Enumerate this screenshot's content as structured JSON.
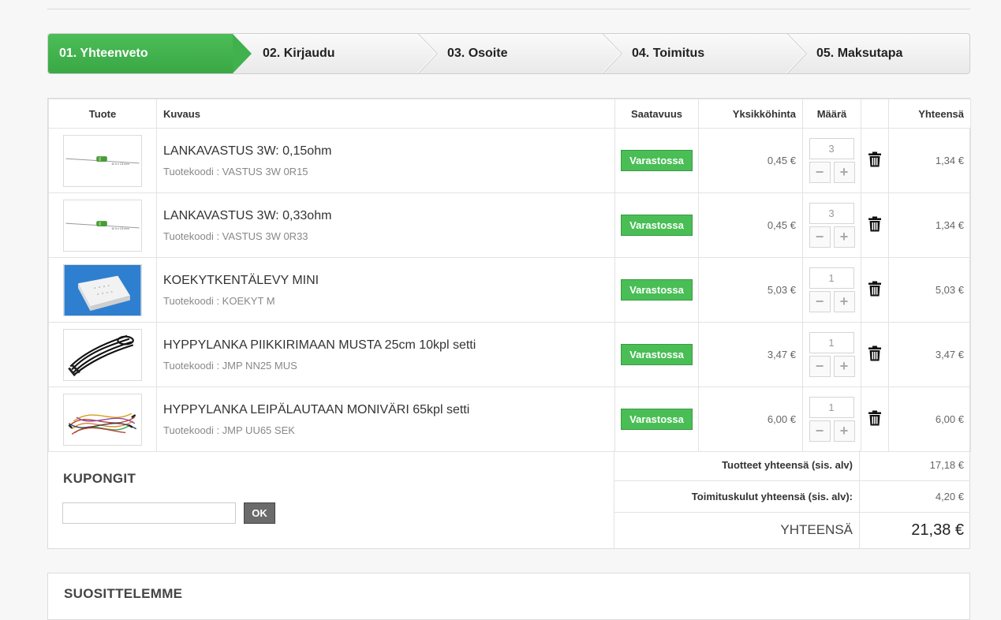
{
  "steps": [
    {
      "label": "01. Yhteenveto",
      "active": true
    },
    {
      "label": "02. Kirjaudu",
      "active": false
    },
    {
      "label": "03. Osoite",
      "active": false
    },
    {
      "label": "04. Toimitus",
      "active": false
    },
    {
      "label": "05. Maksutapa",
      "active": false
    }
  ],
  "table": {
    "headers": {
      "product": "Tuote",
      "description": "Kuvaus",
      "availability": "Saatavuus",
      "unit_price": "Yksikköhinta",
      "quantity": "Määrä",
      "total": "Yhteensä"
    },
    "rows": [
      {
        "name": "LANKAVASTUS 3W: 0,15ohm",
        "code": "Tuotekoodi : VASTUS 3W 0R15",
        "availability": "Varastossa",
        "unit_price": "0,45 €",
        "qty": "3",
        "total": "1,34 €",
        "image": "resistor"
      },
      {
        "name": "LANKAVASTUS 3W: 0,33ohm",
        "code": "Tuotekoodi : VASTUS 3W 0R33",
        "availability": "Varastossa",
        "unit_price": "0,45 €",
        "qty": "3",
        "total": "1,34 €",
        "image": "resistor"
      },
      {
        "name": "KOEKYTKENTÄLEVY MINI",
        "code": "Tuotekoodi : KOEKYT M",
        "availability": "Varastossa",
        "unit_price": "5,03 €",
        "qty": "1",
        "total": "5,03 €",
        "image": "breadboard"
      },
      {
        "name": "HYPPYLANKA PIIKKIRIMAAN MUSTA 25cm 10kpl setti",
        "code": "Tuotekoodi : JMP NN25 MUS",
        "availability": "Varastossa",
        "unit_price": "3,47 €",
        "qty": "1",
        "total": "3,47 €",
        "image": "black-wires"
      },
      {
        "name": "HYPPYLANKA LEIPÄLAUTAAN MONIVÄRI 65kpl setti",
        "code": "Tuotekoodi : JMP UU65 SEK",
        "availability": "Varastossa",
        "unit_price": "6,00 €",
        "qty": "1",
        "total": "6,00 €",
        "image": "color-wires"
      }
    ]
  },
  "coupon": {
    "title": "KUPONGIT",
    "input_value": "",
    "button": "OK"
  },
  "totals": {
    "products_label": "Tuotteet yhteensä (sis. alv)",
    "products_value": "17,18 €",
    "shipping_label": "Toimituskulut yhteensä (sis. alv):",
    "shipping_value": "4,20 €",
    "grand_label": "YHTEENSÄ",
    "grand_value": "21,38 €"
  },
  "recommend": {
    "title": "SUOSITTELEMME"
  },
  "colors": {
    "accent_green": "#49be55",
    "ok_button": "#6b6b6b"
  }
}
